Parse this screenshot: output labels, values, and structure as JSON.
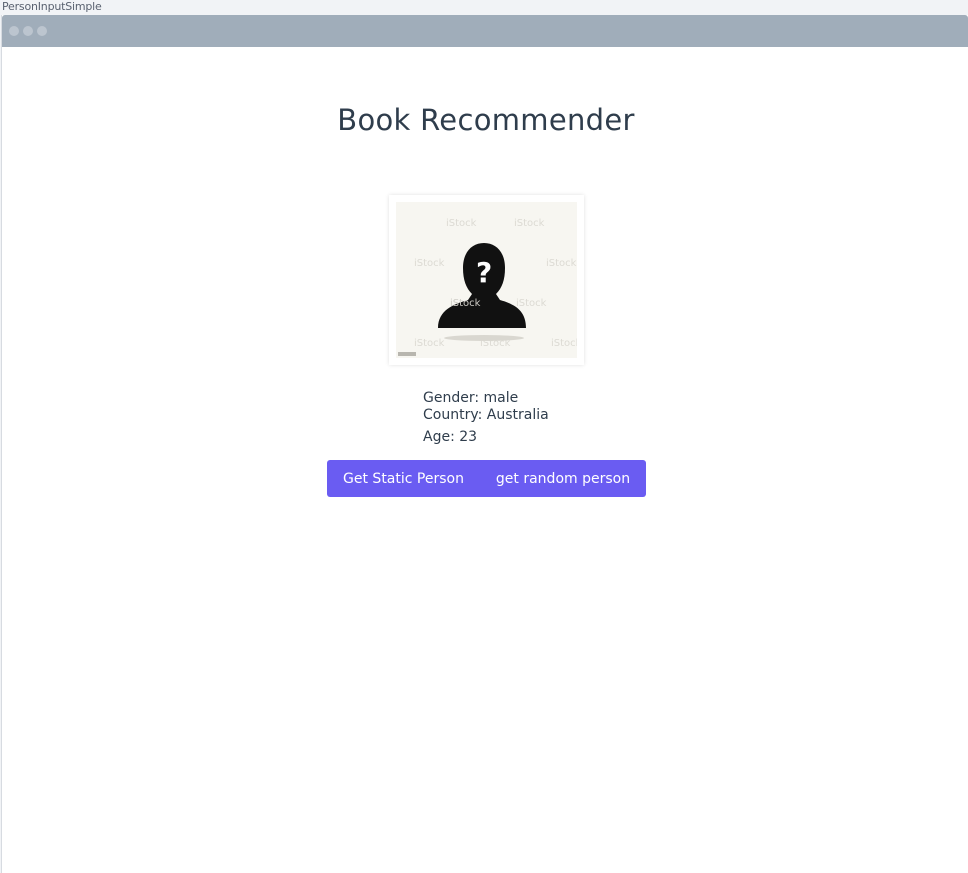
{
  "story": {
    "name": "PersonInputSimple"
  },
  "app": {
    "title": "Book Recommender"
  },
  "avatar": {
    "placeholder_icon": "unknown-person-silhouette-icon",
    "watermark": "iStock"
  },
  "person": {
    "gender_text": "Gender: male",
    "country_text": "Country: Australia",
    "age_text": "Age: 23"
  },
  "actions": {
    "static_label": "Get Static Person",
    "random_label": "get random person"
  },
  "colors": {
    "accent": "#6a5cf2",
    "titlebar": "#a0adba",
    "text": "#2f3d4c"
  }
}
